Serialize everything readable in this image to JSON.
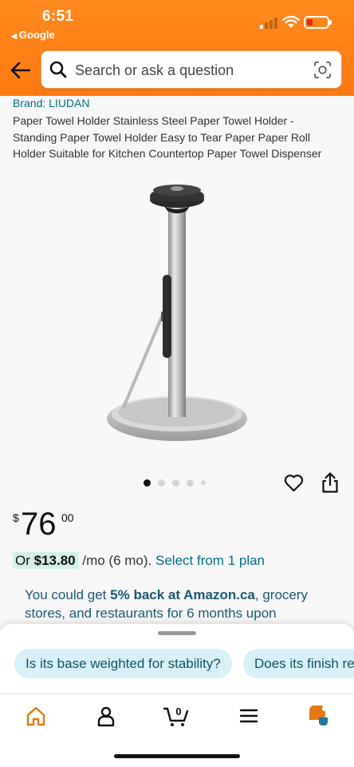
{
  "status_bar": {
    "time": "6:51",
    "back_app": "Google"
  },
  "header": {
    "search_placeholder": "Search or ask a question"
  },
  "product": {
    "brand": "Brand: LIUDAN",
    "title": "Paper Towel Holder Stainless Steel Paper Towel Holder - Standing Paper Towel Holder Easy to Tear Paper Paper Roll Holder Suitable for Kitchen Countertop Paper Towel Dispenser",
    "image_count": 5,
    "active_image_index": 0,
    "price": {
      "currency": "$",
      "whole": "76",
      "fraction": "00"
    },
    "installment": {
      "prefix": "Or",
      "amount": "$13.80",
      "term": "/mo (6 mo).",
      "link": "Select from 1 plan"
    },
    "promo": {
      "prefix": "You could get",
      "bold": "5% back at Amazon.ca",
      "suffix": ", grocery stores, and restaurants for 6 months upon"
    }
  },
  "suggestions": [
    "Is its base weighted for stability?",
    "Does its finish re"
  ],
  "colors": {
    "header_orange": "#ff7a12",
    "link_teal": "#007185",
    "chip_bg": "#d7f1f6",
    "nav_active": "#e47911"
  },
  "nav": {
    "cart_count": "0",
    "items": [
      "home-icon",
      "account-icon",
      "cart-icon",
      "menu-icon",
      "rufus-icon"
    ]
  }
}
